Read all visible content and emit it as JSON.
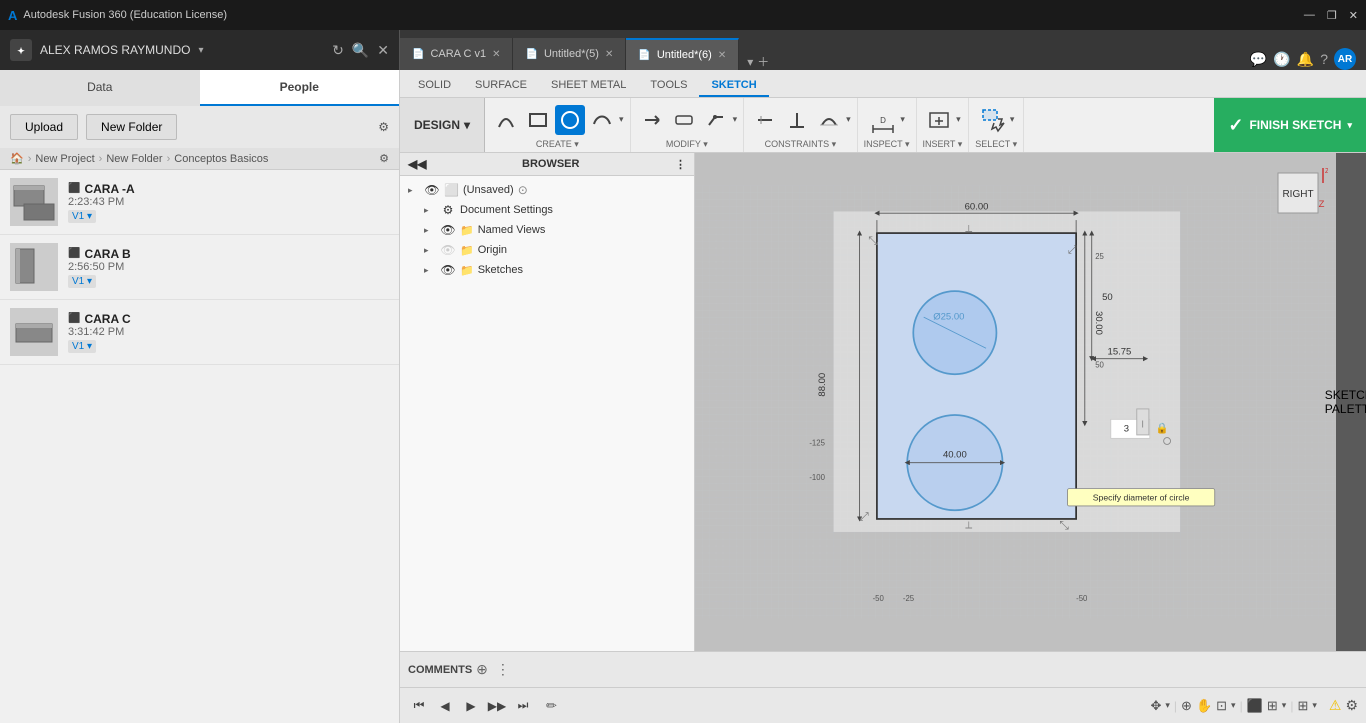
{
  "titlebar": {
    "title": "Autodesk Fusion 360 (Education License)",
    "icon": "A",
    "min": "—",
    "max": "❐",
    "close": "✕"
  },
  "account": {
    "name": "ALEX RAMOS RAYMUNDO",
    "initials": "AR"
  },
  "tabs": [
    {
      "id": "cara-c-v1",
      "label": "CARA C v1",
      "active": false,
      "unsaved": false
    },
    {
      "id": "untitled-5",
      "label": "Untitled*(5)",
      "active": false,
      "unsaved": true
    },
    {
      "id": "untitled-6",
      "label": "Untitled*(6)",
      "active": true,
      "unsaved": true
    }
  ],
  "toolbar": {
    "design_label": "DESIGN",
    "sections": [
      {
        "label": "CREATE",
        "items": [
          "arc",
          "rect",
          "circle",
          "spline"
        ]
      },
      {
        "label": "MODIFY",
        "items": [
          "trim",
          "break",
          "fillet"
        ]
      },
      {
        "label": "CONSTRAINTS",
        "items": [
          "horizontal",
          "perpendicular",
          "tangent"
        ]
      },
      {
        "label": "INSPECT",
        "items": [
          "dimension"
        ]
      },
      {
        "label": "INSERT",
        "items": [
          "insert"
        ]
      },
      {
        "label": "SELECT",
        "items": [
          "select"
        ]
      }
    ],
    "finish_sketch": "FINISH SKETCH"
  },
  "tab_strip": {
    "tabs": [
      {
        "label": "SOLID",
        "active": false
      },
      {
        "label": "SURFACE",
        "active": false
      },
      {
        "label": "SHEET METAL",
        "active": false
      },
      {
        "label": "TOOLS",
        "active": false
      },
      {
        "label": "SKETCH",
        "active": true
      }
    ]
  },
  "panel": {
    "tabs": [
      "Data",
      "People"
    ],
    "active_tab": "People",
    "upload_label": "Upload",
    "new_folder_label": "New Folder",
    "breadcrumb": [
      "🏠",
      "New Project",
      "New Folder",
      "Conceptos Basicos"
    ],
    "files": [
      {
        "name": "CARA -A",
        "time": "2:23:43 PM",
        "version": "V1",
        "thumb": "box"
      },
      {
        "name": "CARA B",
        "time": "2:56:50 PM",
        "version": "V1",
        "thumb": "box"
      },
      {
        "name": "CARA C",
        "time": "3:31:42 PM",
        "version": "V1",
        "thumb": "flat"
      }
    ]
  },
  "browser": {
    "title": "BROWSER",
    "items": [
      {
        "label": "(Unsaved)",
        "type": "root",
        "indent": 0
      },
      {
        "label": "Document Settings",
        "type": "settings",
        "indent": 1
      },
      {
        "label": "Named Views",
        "type": "views",
        "indent": 1
      },
      {
        "label": "Origin",
        "type": "origin",
        "indent": 1
      },
      {
        "label": "Sketches",
        "type": "sketches",
        "indent": 1
      }
    ]
  },
  "sketch_palette": "SKETCH PALETTE",
  "canvas": {
    "dimensions": {
      "width": "60.00",
      "height_left": "88.00",
      "dim_30": "30.00",
      "dim_50": "50",
      "dim_25": "25",
      "dim_125": "-125",
      "dim_100": "-100",
      "dim_50b": "-50",
      "circle1_label": "Ø25.00",
      "circle2_label": "40.00",
      "value_input": "3",
      "dim_1575": "15.75"
    },
    "tooltip": "Specify diameter of circle"
  },
  "comments": {
    "label": "COMMENTS"
  },
  "bottom_controls": {
    "buttons": [
      "⏮",
      "◀",
      "▶",
      "▶▶",
      "⏭"
    ]
  },
  "status": {
    "warning_color": "#f0c000"
  }
}
